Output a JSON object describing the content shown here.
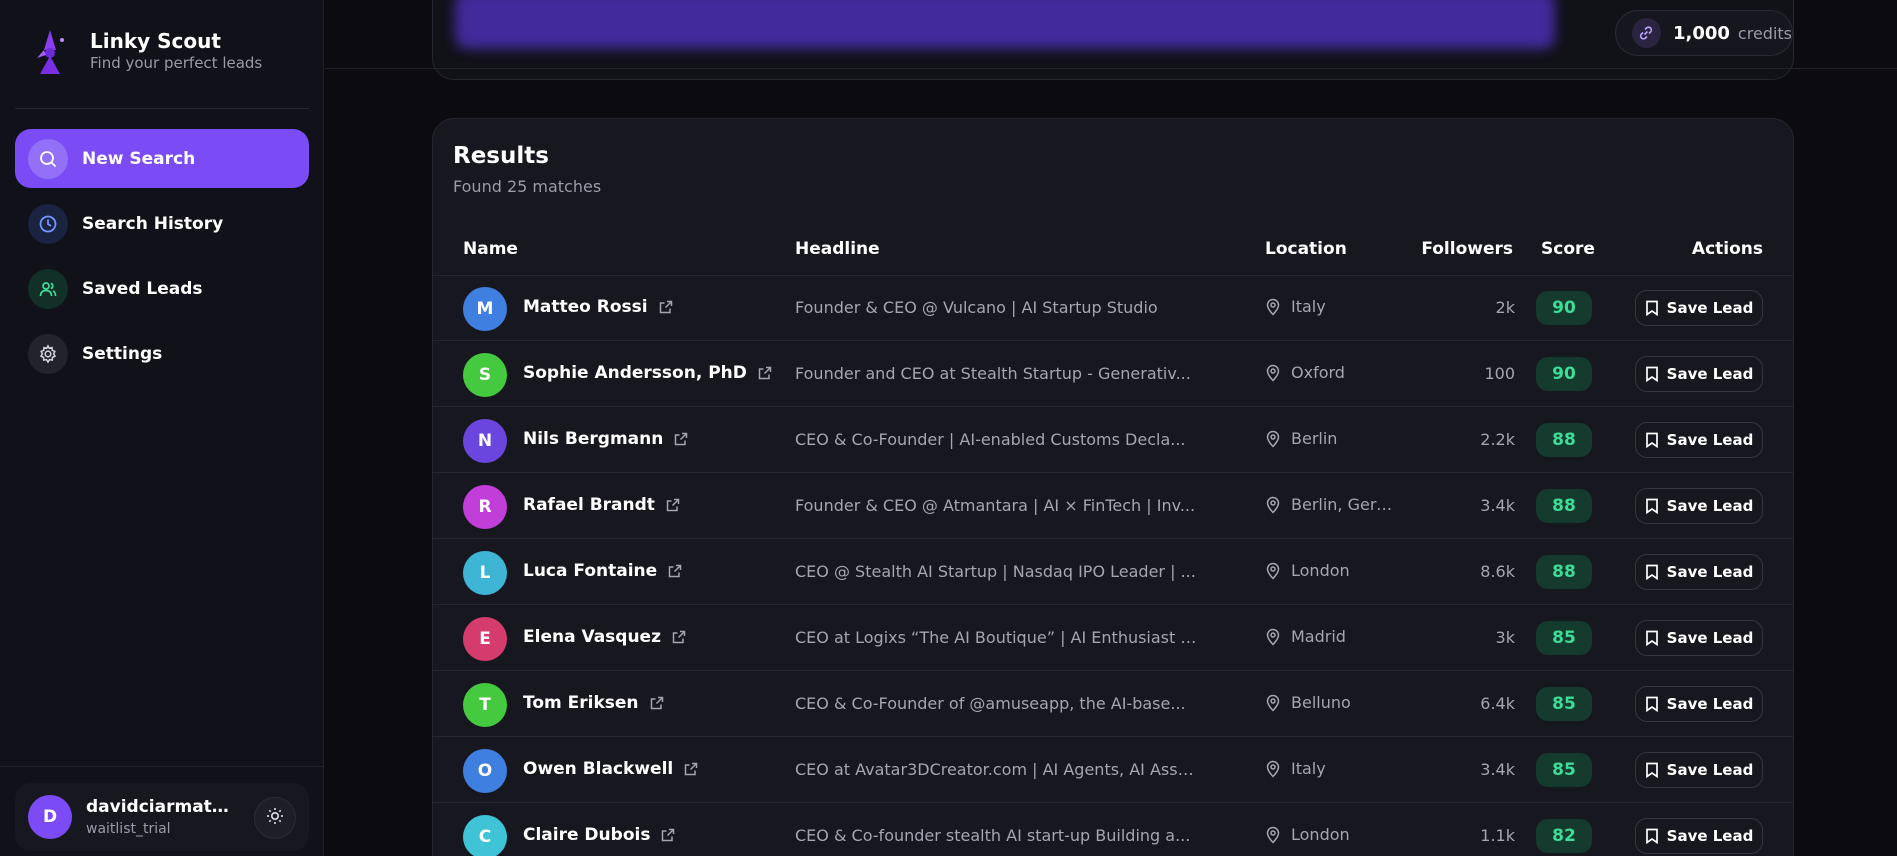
{
  "brand": {
    "title": "Linky Scout",
    "subtitle": "Find your perfect leads"
  },
  "nav": [
    {
      "label": "New Search",
      "icon": "search-icon",
      "active": true
    },
    {
      "label": "Search History",
      "icon": "clock-icon",
      "active": false
    },
    {
      "label": "Saved Leads",
      "icon": "users-icon",
      "active": false
    },
    {
      "label": "Settings",
      "icon": "gear-icon",
      "active": false
    }
  ],
  "user": {
    "initial": "D",
    "name": "davidciarmatori...",
    "plan": "waitlist_trial"
  },
  "credits": {
    "value": "1,000",
    "label": "credits"
  },
  "results": {
    "title": "Results",
    "subtitle": "Found 25 matches",
    "columns": {
      "name": "Name",
      "headline": "Headline",
      "location": "Location",
      "followers": "Followers",
      "score": "Score",
      "actions": "Actions"
    },
    "save_label": "Save Lead",
    "rows": [
      {
        "initial": "M",
        "avatar_color": "#3f7fe0",
        "name": "Matteo Rossi",
        "headline": "Founder & CEO @ Vulcano | AI Startup Studio",
        "location": "Italy",
        "followers": "2k",
        "score": "90"
      },
      {
        "initial": "S",
        "avatar_color": "#44c93f",
        "name": "Sophie Andersson, PhD",
        "headline": "Founder and CEO at Stealth Startup - Generativ...",
        "location": "Oxford",
        "followers": "100",
        "score": "90"
      },
      {
        "initial": "N",
        "avatar_color": "#6a45de",
        "name": "Nils Bergmann",
        "headline": "CEO & Co-Founder | AI-enabled Customs Decla...",
        "location": "Berlin",
        "followers": "2.2k",
        "score": "88"
      },
      {
        "initial": "R",
        "avatar_color": "#c13ed8",
        "name": "Rafael Brandt",
        "headline": "Founder & CEO @ Atmantara | AI × FinTech | Inv...",
        "location": "Berlin, Germ...",
        "followers": "3.4k",
        "score": "88"
      },
      {
        "initial": "L",
        "avatar_color": "#3fb5d6",
        "name": "Luca Fontaine",
        "headline": "CEO @ Stealth AI Startup | Nasdaq IPO Leader | ...",
        "location": "London",
        "followers": "8.6k",
        "score": "88"
      },
      {
        "initial": "E",
        "avatar_color": "#d43c6e",
        "name": "Elena Vasquez",
        "headline": "CEO at Logixs “The AI Boutique” | AI Enthusiast | ...",
        "location": "Madrid",
        "followers": "3k",
        "score": "85"
      },
      {
        "initial": "T",
        "avatar_color": "#44c93f",
        "name": "Tom Eriksen",
        "headline": "CEO & Co-Founder of @amuseapp, the AI-base...",
        "location": "Belluno",
        "followers": "6.4k",
        "score": "85"
      },
      {
        "initial": "O",
        "avatar_color": "#3f7fe0",
        "name": "Owen Blackwell",
        "headline": "CEO at Avatar3DCreator.com | AI Agents, AI Assi...",
        "location": "Italy",
        "followers": "3.4k",
        "score": "85"
      },
      {
        "initial": "C",
        "avatar_color": "#3fc3d6",
        "name": "Claire Dubois",
        "headline": "CEO & Co-founder stealth AI start-up Building a...",
        "location": "London",
        "followers": "1.1k",
        "score": "82"
      }
    ]
  },
  "colors": {
    "accent": "#7b4cf5",
    "score_bg": "#153a2e",
    "score_text": "#3ddc97",
    "background": "#0b0b10"
  }
}
